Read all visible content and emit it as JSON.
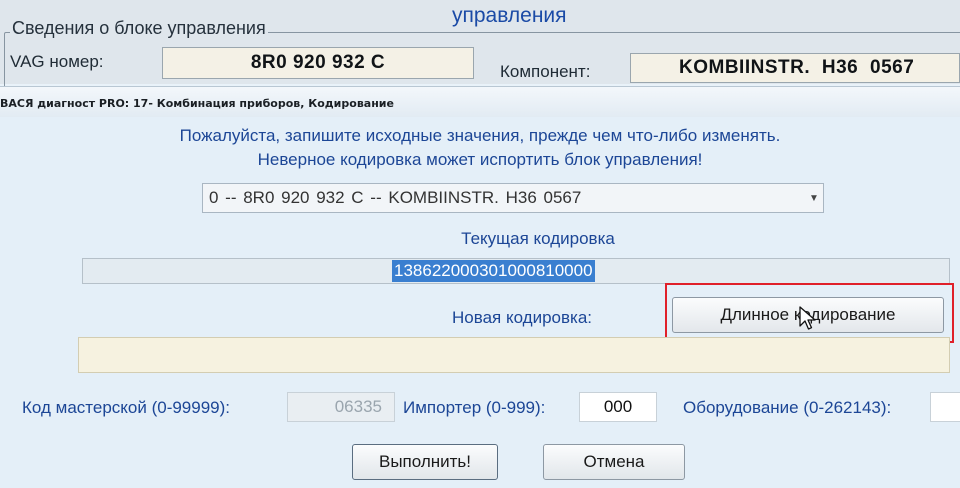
{
  "module_header": {
    "title": "управления",
    "group_label": "Сведения о блоке управления",
    "vag_label": "VAG номер:",
    "vag_value": "8R0 920 932 C",
    "component_label": "Компонент:",
    "component_value": "KOMBIINSTR.  H36 0567"
  },
  "dialog": {
    "window_title": "ВАСЯ диагност PRO: 17- Комбинация приборов,  Кодирование",
    "warning_line1": "Пожалуйста, запишите исходные значения, прежде чем что-либо изменять.",
    "warning_line2": "Неверное кодировка может испортить блок управления!",
    "module_select_value": "0 -- 8R0 920 932 C -- KOMBIINSTR.   H36 0567",
    "current_coding_label": "Текущая кодировка",
    "current_coding_value": "138622000301000810000",
    "new_coding_label": "Новая кодировка:",
    "new_coding_value": "",
    "long_coding_button": "Длинное кодирование",
    "workshop_code_label": "Код мастерской (0-99999):",
    "workshop_code_value": "06335",
    "importer_label": "Импортер (0-999):",
    "importer_value": "000",
    "equipment_label": "Оборудование (0-262143):",
    "equipment_value": "",
    "execute_button": "Выполнить!",
    "cancel_button": "Отмена"
  },
  "icons": [
    "chevron-down-icon",
    "mouse-cursor-icon"
  ],
  "colors": {
    "label_blue": "#1c4696",
    "selection_blue": "#3a7fd0",
    "highlight_red": "#e0202a",
    "readonly_field": "#f4f1e6"
  }
}
